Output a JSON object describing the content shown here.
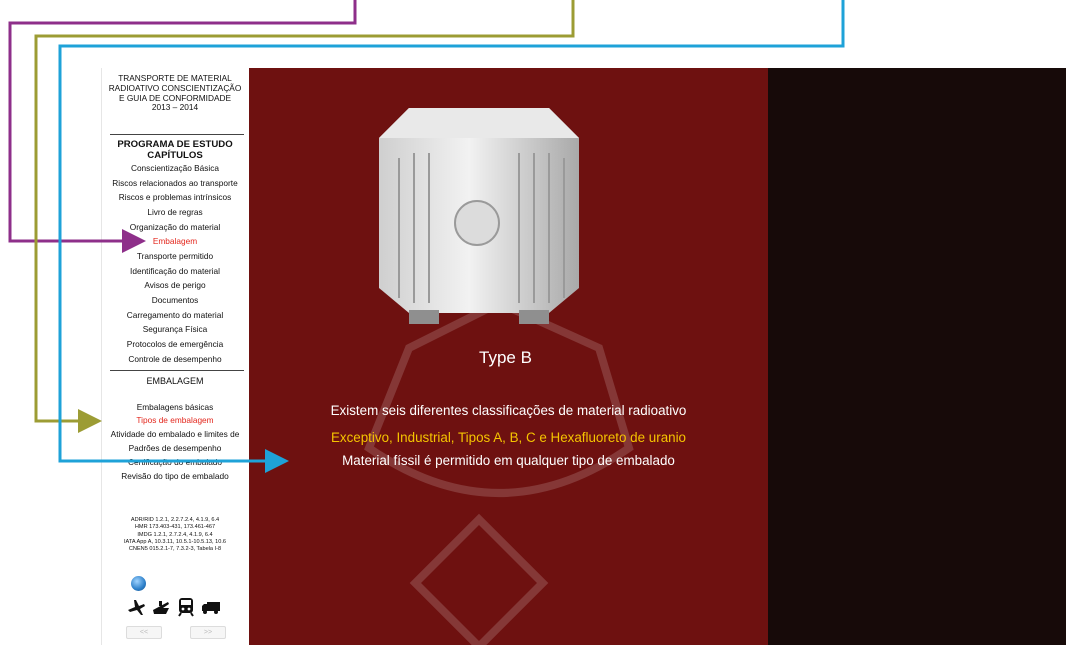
{
  "sidebar": {
    "header": {
      "line1": "TRANSPORTE DE MATERIAL",
      "line2": "RADIOATIVO CONSCIENTIZAÇÃO",
      "line3": "E GUIA DE CONFORMIDADE",
      "years": "2013 – 2014"
    },
    "section_title_1": "PROGRAMA DE ESTUDO",
    "section_title_2": "CAPÍTULOS",
    "chapters": [
      "Conscientização Básica",
      "Riscos relacionados ao transporte",
      "Riscos e problemas intrínsicos",
      "Livro de regras",
      "Organização do material",
      "Embalagem",
      "Transporte permitido",
      "Identificação do material",
      "Avisos de perigo",
      "Documentos",
      "Carregamento do material",
      "Segurança Física",
      "Protocolos de emergência",
      "Controle de desempenho"
    ],
    "subsection_title": "EMBALAGEM",
    "subitems": [
      "Embalagens básicas",
      "Tipos de embalagem",
      "Atividade do embalado e limites de",
      "Padrões de desempenho",
      "Certificação do embalado",
      "Revisão do tipo de embalado"
    ],
    "references": [
      "ADR/RID 1.2.1, 2.2.7.2.4, 4.1.9, 6.4",
      "HMR 173.403-431, 173.461-467",
      "IMDG 1.2.1, 2.7.2.4, 4.1.9, 6.4",
      "IATA App A, 10.3.11, 10.5.1-10.5.13, 10.6",
      "CNEN5 015.2.1-7, 7.3.2-3, Tabela I-8"
    ],
    "nav": {
      "prev": "<<",
      "next": ">>"
    }
  },
  "main": {
    "image_label": "Type B",
    "caption_1": "Existem seis diferentes classificações de material radioativo",
    "caption_2": "Exceptivo, Industrial, Tipos A, B, C e Hexafluoreto de uranio",
    "caption_3": "Material físsil é permitido em qualquer tipo de embalado"
  },
  "colors": {
    "main_bg": "#6e1110",
    "right_bg": "#170a09",
    "active_red": "#e3261c",
    "highlight_yellow": "#f5c400",
    "arrow_purple": "#8e2f8a",
    "arrow_olive": "#9c9c34",
    "arrow_blue": "#1ea2d8"
  },
  "icons": [
    "globe-icon",
    "airplane-icon",
    "ship-icon",
    "train-icon",
    "truck-icon"
  ]
}
